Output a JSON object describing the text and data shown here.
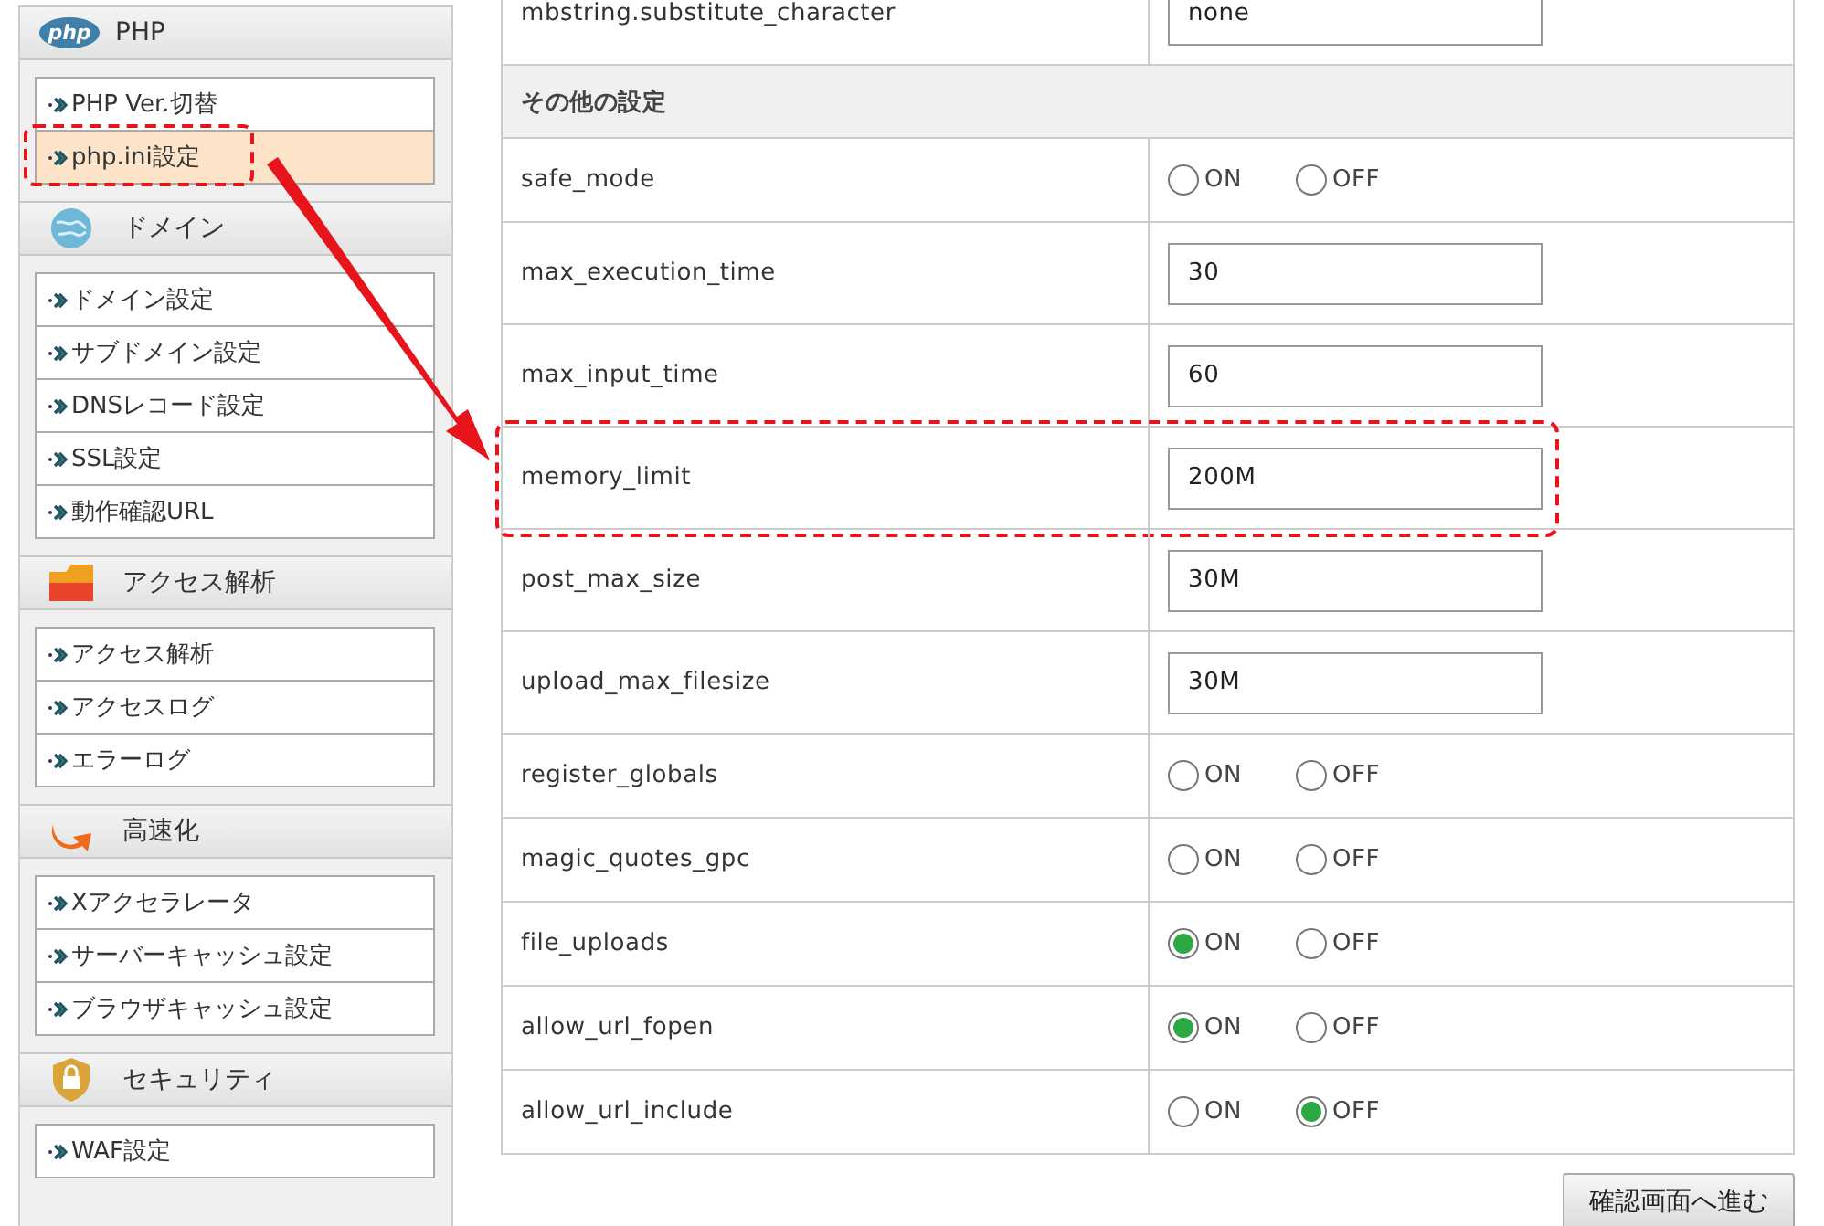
{
  "sidebar": {
    "sections": [
      {
        "title": "PHP",
        "kind": "php",
        "badge": "php",
        "items": [
          {
            "label": "PHP Ver.切替",
            "selected": false,
            "highlighted": false
          },
          {
            "label": "php.ini設定",
            "selected": true,
            "highlighted": true
          }
        ]
      },
      {
        "title": "ドメイン",
        "kind": "globe",
        "items": [
          {
            "label": "ドメイン設定",
            "selected": false,
            "highlighted": false
          },
          {
            "label": "サブドメイン設定",
            "selected": false,
            "highlighted": false
          },
          {
            "label": "DNSレコード設定",
            "selected": false,
            "highlighted": false
          },
          {
            "label": "SSL設定",
            "selected": false,
            "highlighted": false
          },
          {
            "label": "動作確認URL",
            "selected": false,
            "highlighted": false
          }
        ]
      },
      {
        "title": "アクセス解析",
        "kind": "folder",
        "items": [
          {
            "label": "アクセス解析",
            "selected": false,
            "highlighted": false
          },
          {
            "label": "アクセスログ",
            "selected": false,
            "highlighted": false
          },
          {
            "label": "エラーログ",
            "selected": false,
            "highlighted": false
          }
        ]
      },
      {
        "title": "高速化",
        "kind": "speed",
        "items": [
          {
            "label": "Xアクセラレータ",
            "selected": false,
            "highlighted": false
          },
          {
            "label": "サーバーキャッシュ設定",
            "selected": false,
            "highlighted": false
          },
          {
            "label": "ブラウザキャッシュ設定",
            "selected": false,
            "highlighted": false
          }
        ]
      },
      {
        "title": "セキュリティ",
        "kind": "shield",
        "items": [
          {
            "label": "WAF設定",
            "selected": false,
            "highlighted": false
          }
        ]
      }
    ]
  },
  "settings": {
    "rows": [
      {
        "kind": "text",
        "name": "mbstring.substitute_character",
        "value": "none",
        "highlighted": false
      },
      {
        "kind": "section",
        "name": "その他の設定"
      },
      {
        "kind": "radio",
        "name": "safe_mode",
        "options": [
          {
            "label": "ON",
            "selected": false
          },
          {
            "label": "OFF",
            "selected": false
          }
        ]
      },
      {
        "kind": "text",
        "name": "max_execution_time",
        "value": "30",
        "highlighted": false
      },
      {
        "kind": "text",
        "name": "max_input_time",
        "value": "60",
        "highlighted": false
      },
      {
        "kind": "text",
        "name": "memory_limit",
        "value": "200M",
        "highlighted": true
      },
      {
        "kind": "text",
        "name": "post_max_size",
        "value": "30M",
        "highlighted": false
      },
      {
        "kind": "text",
        "name": "upload_max_filesize",
        "value": "30M",
        "highlighted": false
      },
      {
        "kind": "radio",
        "name": "register_globals",
        "options": [
          {
            "label": "ON",
            "selected": false
          },
          {
            "label": "OFF",
            "selected": false
          }
        ]
      },
      {
        "kind": "radio",
        "name": "magic_quotes_gpc",
        "options": [
          {
            "label": "ON",
            "selected": false
          },
          {
            "label": "OFF",
            "selected": false
          }
        ]
      },
      {
        "kind": "radio",
        "name": "file_uploads",
        "options": [
          {
            "label": "ON",
            "selected": true
          },
          {
            "label": "OFF",
            "selected": false
          }
        ]
      },
      {
        "kind": "radio",
        "name": "allow_url_fopen",
        "options": [
          {
            "label": "ON",
            "selected": true
          },
          {
            "label": "OFF",
            "selected": false
          }
        ]
      },
      {
        "kind": "radio",
        "name": "allow_url_include",
        "options": [
          {
            "label": "ON",
            "selected": false
          },
          {
            "label": "OFF",
            "selected": true
          }
        ]
      }
    ],
    "submit_button": "確認画面へ進む"
  },
  "annotations": {
    "arrow": true
  }
}
